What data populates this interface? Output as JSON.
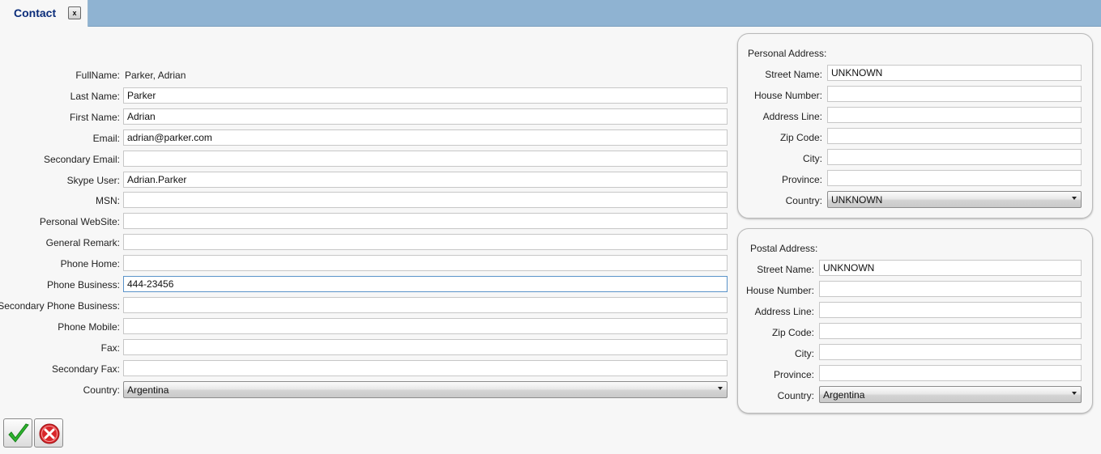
{
  "tab": {
    "title": "Contact",
    "close_label": "x"
  },
  "form": {
    "fullname_label": "FullName:",
    "fullname_value": "Parker, Adrian",
    "lastname_label": "Last Name:",
    "lastname_value": "Parker",
    "firstname_label": "First Name:",
    "firstname_value": "Adrian",
    "email_label": "Email:",
    "email_value": "adrian@parker.com",
    "secondary_email_label": "Secondary Email:",
    "secondary_email_value": "",
    "skype_label": "Skype User:",
    "skype_value": "Adrian.Parker",
    "msn_label": "MSN:",
    "msn_value": "",
    "website_label": "Personal WebSite:",
    "website_value": "",
    "remark_label": "General Remark:",
    "remark_value": "",
    "phone_home_label": "Phone Home:",
    "phone_home_value": "",
    "phone_business_label": "Phone Business:",
    "phone_business_value": "444-23456",
    "secondary_phone_business_label": "Secondary Phone Business:",
    "secondary_phone_business_value": "",
    "phone_mobile_label": "Phone Mobile:",
    "phone_mobile_value": "",
    "fax_label": "Fax:",
    "fax_value": "",
    "secondary_fax_label": "Secondary Fax:",
    "secondary_fax_value": "",
    "country_label": "Country:",
    "country_value": "Argentina"
  },
  "personal_address": {
    "title": "Personal Address:",
    "street_label": "Street Name:",
    "street_value": "UNKNOWN",
    "house_label": "House Number:",
    "house_value": "",
    "address_line_label": "Address Line:",
    "address_line_value": "",
    "zip_label": "Zip Code:",
    "zip_value": "",
    "city_label": "City:",
    "city_value": "",
    "province_label": "Province:",
    "province_value": "",
    "country_label": "Country:",
    "country_value": "UNKNOWN"
  },
  "postal_address": {
    "title": "Postal Address:",
    "street_label": "Street Name:",
    "street_value": "UNKNOWN",
    "house_label": "House Number:",
    "house_value": "",
    "address_line_label": "Address Line:",
    "address_line_value": "",
    "zip_label": "Zip Code:",
    "zip_value": "",
    "city_label": "City:",
    "city_value": "",
    "province_label": "Province:",
    "province_value": "",
    "country_label": "Country:",
    "country_value": "Argentina"
  },
  "buttons": {
    "confirm_icon": "checkmark-icon",
    "cancel_icon": "cancel-icon"
  },
  "colors": {
    "tabbar": "#8fb3d2",
    "tab_title": "#0b2d7a",
    "confirm": "#2db32d",
    "cancel": "#d9262a"
  }
}
